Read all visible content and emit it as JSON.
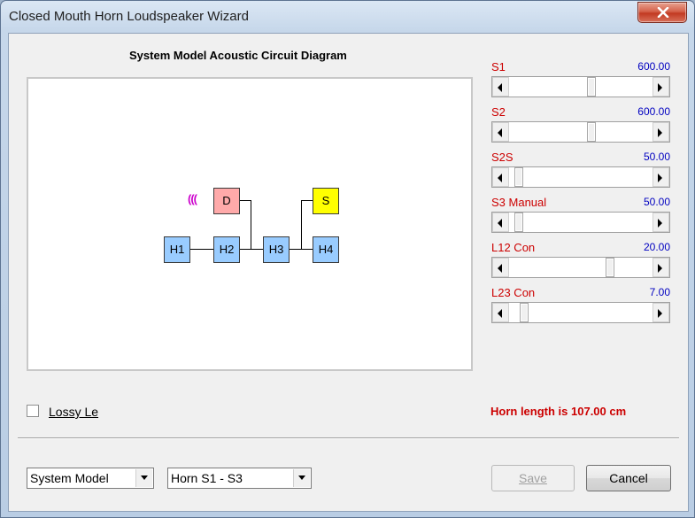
{
  "window": {
    "title": "Closed Mouth Horn Loudspeaker Wizard"
  },
  "diagram": {
    "title": "System Model Acoustic Circuit Diagram",
    "wave_glyph": "(((",
    "nodes": {
      "D": "D",
      "S": "S",
      "H1": "H1",
      "H2": "H2",
      "H3": "H3",
      "H4": "H4"
    }
  },
  "params": [
    {
      "label": "S1",
      "value": "600.00",
      "level": 0.58
    },
    {
      "label": "S2",
      "value": "600.00",
      "level": 0.58
    },
    {
      "label": "S2S",
      "value": "50.00",
      "level": 0.04
    },
    {
      "label": "S3 Manual",
      "value": "50.00",
      "level": 0.04
    },
    {
      "label": "L12 Con",
      "value": "20.00",
      "level": 0.72
    },
    {
      "label": "L23 Con",
      "value": "7.00",
      "level": 0.08
    }
  ],
  "options": {
    "lossy_label": "Lossy Le",
    "lossy_checked": false
  },
  "status": {
    "horn_length": "Horn length is 107.00 cm"
  },
  "footer": {
    "model_select": "System Model",
    "horn_select": "Horn S1 - S3",
    "save_label": "Save",
    "cancel_label": "Cancel"
  },
  "colors": {
    "label_red": "#cc0000",
    "value_blue": "#0000c0",
    "node_blue": "#99ccff",
    "node_pink": "#ffaaaa",
    "node_yellow": "#ffff00"
  }
}
